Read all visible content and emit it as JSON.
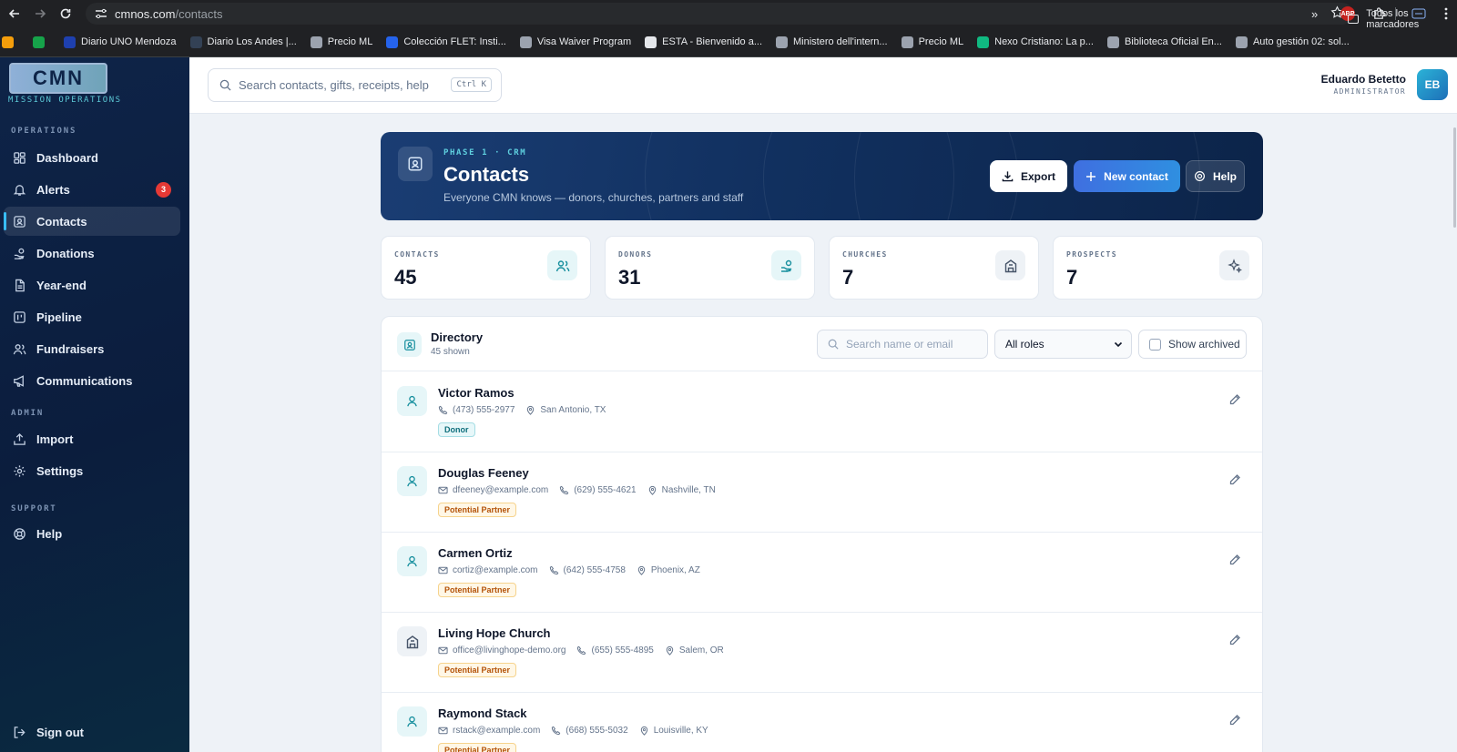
{
  "browser": {
    "url_host": "cmnos.com",
    "url_path": "/contacts",
    "bookmarks": [
      {
        "label": "",
        "color": "#f59e0b"
      },
      {
        "label": "",
        "color": "#16a34a"
      },
      {
        "label": "Diario UNO Mendoza",
        "color": "#1e40af"
      },
      {
        "label": "Diario Los Andes |...",
        "color": "#334155"
      },
      {
        "label": "Precio ML",
        "color": "#9ca3af"
      },
      {
        "label": "Colección FLET: Insti...",
        "color": "#2563eb"
      },
      {
        "label": "Visa Waiver Program",
        "color": "#9ca3af"
      },
      {
        "label": "ESTA - Bienvenido a...",
        "color": "#e5e7eb"
      },
      {
        "label": "Ministero dell'intern...",
        "color": "#9ca3af"
      },
      {
        "label": "Precio ML",
        "color": "#9ca3af"
      },
      {
        "label": "Nexo Cristiano: La p...",
        "color": "#10b981"
      },
      {
        "label": "Biblioteca Oficial En...",
        "color": "#9ca3af"
      },
      {
        "label": "Auto gestión 02: sol...",
        "color": "#9ca3af"
      }
    ],
    "all_bookmarks": "Todos los marcadores",
    "abp": "ABP"
  },
  "brand": {
    "logo": "CMN",
    "subtitle": "MISSION OPERATIONS"
  },
  "sidebar": {
    "sections": {
      "operations": "OPERATIONS",
      "admin": "ADMIN",
      "support": "SUPPORT"
    },
    "items": {
      "dashboard": "Dashboard",
      "alerts": "Alerts",
      "alerts_count": "3",
      "contacts": "Contacts",
      "donations": "Donations",
      "yearend": "Year-end",
      "pipeline": "Pipeline",
      "fundraisers": "Fundraisers",
      "communications": "Communications",
      "import": "Import",
      "settings": "Settings",
      "help": "Help"
    },
    "signout": "Sign out"
  },
  "header": {
    "search_placeholder": "Search contacts, gifts, receipts, help",
    "search_shortcut": "Ctrl K",
    "user_name": "Eduardo Betetto",
    "user_role": "ADMINISTRATOR",
    "user_initials": "EB"
  },
  "hero": {
    "eyebrow": "PHASE 1 · CRM",
    "title": "Contacts",
    "subtitle": "Everyone CMN knows — donors, churches, partners and staff",
    "export_label": "Export",
    "new_label": "New contact",
    "help_label": "Help"
  },
  "stats": [
    {
      "label": "CONTACTS",
      "value": "45",
      "icon": "users-icon",
      "bg": "#e6f6f8",
      "fg": "#178f9e"
    },
    {
      "label": "DONORS",
      "value": "31",
      "icon": "hand-coins-icon",
      "bg": "#e6f6f8",
      "fg": "#178f9e"
    },
    {
      "label": "CHURCHES",
      "value": "7",
      "icon": "church-icon",
      "bg": "#eef2f6",
      "fg": "#475569"
    },
    {
      "label": "PROSPECTS",
      "value": "7",
      "icon": "sparkles-icon",
      "bg": "#eef2f6",
      "fg": "#475569"
    }
  ],
  "directory": {
    "title": "Directory",
    "count": "45 shown",
    "search_placeholder": "Search name or email",
    "role_filter": "All roles",
    "show_archived": "Show archived"
  },
  "contacts": [
    {
      "name": "Victor Ramos",
      "email": "",
      "phone": "(473) 555-2977",
      "location": "San Antonio, TX",
      "tag": "Donor",
      "tag_type": "donor",
      "kind": "person"
    },
    {
      "name": "Douglas Feeney",
      "email": "dfeeney@example.com",
      "phone": "(629) 555-4621",
      "location": "Nashville, TN",
      "tag": "Potential Partner",
      "tag_type": "partner",
      "kind": "person"
    },
    {
      "name": "Carmen Ortiz",
      "email": "cortiz@example.com",
      "phone": "(642) 555-4758",
      "location": "Phoenix, AZ",
      "tag": "Potential Partner",
      "tag_type": "partner",
      "kind": "person"
    },
    {
      "name": "Living Hope Church",
      "email": "office@livinghope-demo.org",
      "phone": "(655) 555-4895",
      "location": "Salem, OR",
      "tag": "Potential Partner",
      "tag_type": "partner",
      "kind": "church"
    },
    {
      "name": "Raymond Stack",
      "email": "rstack@example.com",
      "phone": "(668) 555-5032",
      "location": "Louisville, KY",
      "tag": "Potential Partner",
      "tag_type": "partner",
      "kind": "person"
    }
  ]
}
